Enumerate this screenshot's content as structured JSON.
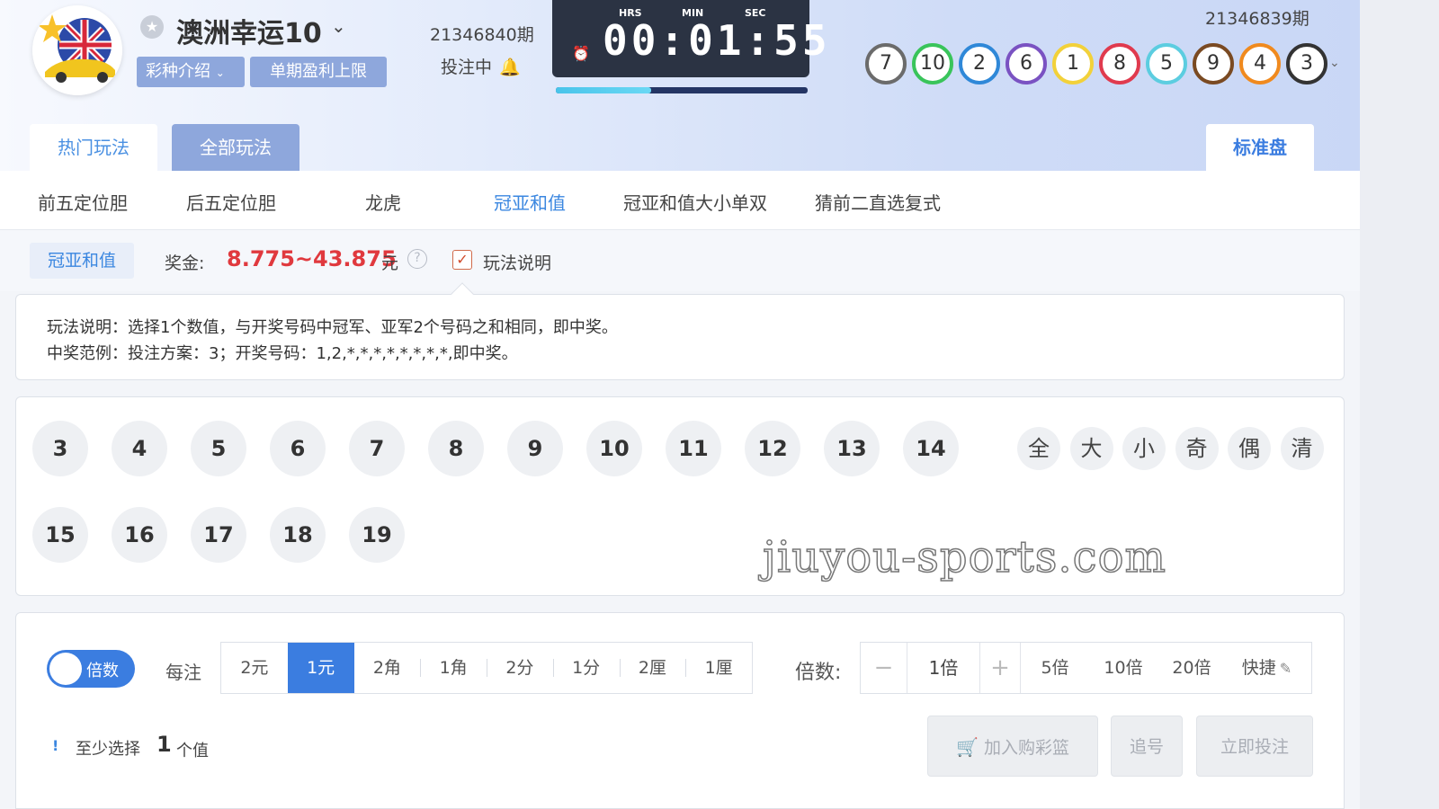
{
  "header": {
    "game_title": "澳洲幸运10",
    "tag_intro": "彩种介绍",
    "tag_limit": "单期盈利上限",
    "current_period": "21346840期",
    "status": "投注中",
    "timer": {
      "hrs_label": "HRS",
      "min_label": "MIN",
      "sec_label": "SEC",
      "time": "00:01:55"
    },
    "progress_fraction": 0.38,
    "last_period": "21346839期",
    "last_draw": [
      {
        "n": "7",
        "color": "#6b6b6b"
      },
      {
        "n": "10",
        "color": "#39c45a"
      },
      {
        "n": "2",
        "color": "#2f88d8"
      },
      {
        "n": "6",
        "color": "#7a52c2"
      },
      {
        "n": "1",
        "color": "#f2d13a"
      },
      {
        "n": "8",
        "color": "#e03a4e"
      },
      {
        "n": "5",
        "color": "#5ccde0"
      },
      {
        "n": "9",
        "color": "#7a4a22"
      },
      {
        "n": "4",
        "color": "#f08a1e"
      },
      {
        "n": "3",
        "color": "#333333"
      }
    ]
  },
  "tabs": {
    "hot": "热门玩法",
    "all": "全部玩法",
    "standard": "标准盘"
  },
  "subtabs": [
    "前五定位胆",
    "后五定位胆",
    "龙虎",
    "冠亚和值",
    "冠亚和值大小单双",
    "猜前二直选复式"
  ],
  "prize": {
    "method": "冠亚和值",
    "label": "奖金:",
    "value": "8.775~43.875",
    "unit": "元",
    "rules_label": "玩法说明"
  },
  "explain": {
    "line1": "玩法说明：选择1个数值，与开奖号码中冠军、亚军2个号码之和相同，即中奖。",
    "line2": "中奖范例：投注方案：3；开奖号码：1,2,*,*,*,*,*,*,*,*,即中奖。"
  },
  "numbers": [
    "3",
    "4",
    "5",
    "6",
    "7",
    "8",
    "9",
    "10",
    "11",
    "12",
    "13",
    "14",
    "15",
    "16",
    "17",
    "18",
    "19"
  ],
  "quick_picks": [
    "全",
    "大",
    "小",
    "奇",
    "偶",
    "清"
  ],
  "watermark": "jiuyou-sports.com",
  "bet": {
    "toggle_label": "倍数",
    "per_bet_label": "每注",
    "units": [
      "2元",
      "1元",
      "2角",
      "1角",
      "2分",
      "1分",
      "2厘",
      "1厘"
    ],
    "active_unit": "1元",
    "multiplier_label": "倍数:",
    "minus": "−",
    "multiplier_value": "1倍",
    "plus": "+",
    "presets": [
      "5倍",
      "10倍",
      "20倍"
    ],
    "quick_label": "快捷",
    "hint_icon": "!",
    "hint_prefix": "至少选择",
    "hint_count": "1",
    "hint_suffix": "个值",
    "add_cart": "加入购彩篮",
    "chase": "追号",
    "bet_now": "立即投注"
  },
  "colors": {
    "accent": "#3b7de0",
    "prize": "#e0393e",
    "tag": "#8ea7dc"
  }
}
